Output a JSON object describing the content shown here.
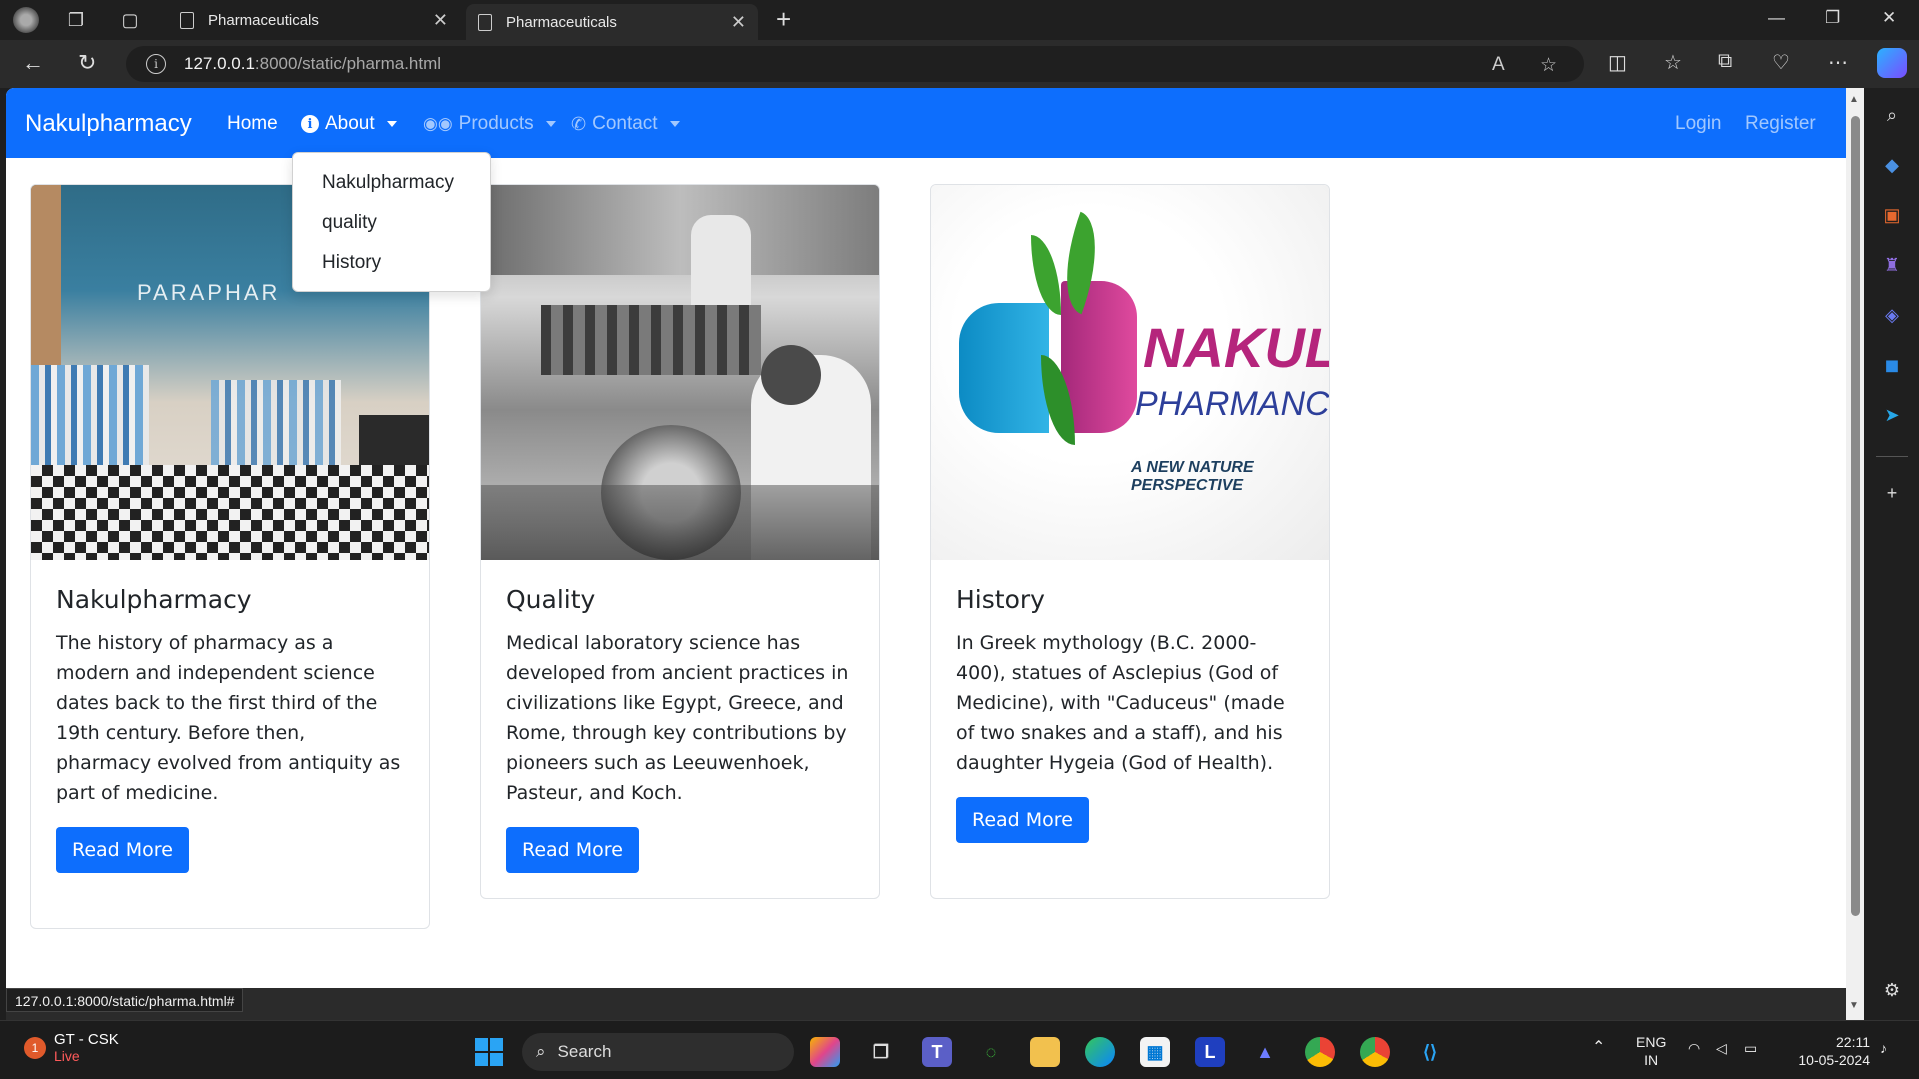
{
  "browser": {
    "tabs": [
      {
        "title": "Pharmaceuticals",
        "active": false
      },
      {
        "title": "Pharmaceuticals",
        "active": true
      }
    ],
    "url_host": "127.0.0.1",
    "url_path": ":8000/static/pharma.html",
    "status_url": "127.0.0.1:8000/static/pharma.html#"
  },
  "navbar": {
    "brand": "Nakulpharmacy",
    "links": {
      "home": "Home",
      "about": "About",
      "products": "Products",
      "contact": "Contact",
      "login": "Login",
      "register": "Register"
    },
    "about_dropdown": [
      "Nakulpharmacy",
      "quality",
      "History"
    ]
  },
  "cards": [
    {
      "title": "Nakulpharmacy",
      "text": "The history of pharmacy as a modern and independent science dates back to the first third of the 19th century. Before then, pharmacy evolved from antiquity as part of medicine.",
      "button": "Read More",
      "image_sign": "PARAPHAR"
    },
    {
      "title": "Quality",
      "text": "Medical laboratory science has developed from ancient practices in civilizations like Egypt, Greece, and Rome, through key contributions by pioneers such as Leeuwenhoek, Pasteur, and Koch.",
      "button": "Read More"
    },
    {
      "title": "History",
      "text": "In Greek mythology (B.C. 2000-400), statues of Asclepius (God of Medicine), with \"Caduceus\" (made of two snakes and a staff), and his daughter Hygeia (God of Health).",
      "button": "Read More",
      "logo": {
        "main": "NAKUL",
        "sub": "PHARMANCY",
        "tag": "A NEW NATURE PERSPECTIVE"
      }
    }
  ],
  "taskbar": {
    "weather_title": "GT - CSK",
    "weather_sub": "Live",
    "weather_badge": "1",
    "search": "Search",
    "lang_top": "ENG",
    "lang_bottom": "IN",
    "time": "22:11",
    "date": "10-05-2024"
  },
  "colors": {
    "navbar": "#0d6efd",
    "button": "#0d6efd"
  }
}
